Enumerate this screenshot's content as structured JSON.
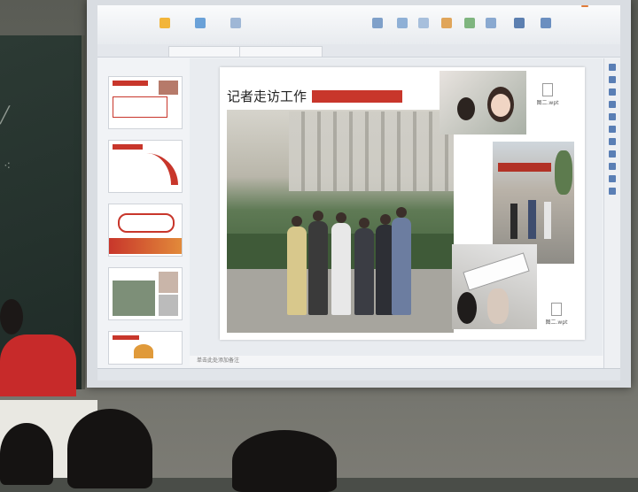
{
  "scene": "classroom projection of a presentation slide",
  "app": {
    "ribbon": {
      "account_button": "",
      "buttons": [
        "",
        "",
        "",
        "",
        "",
        "",
        "",
        "",
        "",
        "",
        ""
      ]
    },
    "doc_tabs": [
      "",
      ""
    ],
    "pane_tabs": [
      "",
      ""
    ],
    "thumbnails": [
      {
        "num": "",
        "theme": "report"
      },
      {
        "num": "",
        "theme": "road"
      },
      {
        "num": "",
        "theme": "banner"
      },
      {
        "num": "",
        "theme": "photos"
      },
      {
        "num": "",
        "theme": "chart"
      }
    ],
    "slide": {
      "title": "记者走访工作",
      "banner_text": "",
      "file_chips": [
        "图二.wpt",
        "图二.wpt"
      ]
    },
    "notes_placeholder": "单击此处添加备注",
    "status": {
      "left": "",
      "middle": "",
      "right": ""
    }
  },
  "colors": {
    "accent_red": "#c8362b",
    "ribbon": "#f1f3f6",
    "status": "#e1e5ea"
  }
}
